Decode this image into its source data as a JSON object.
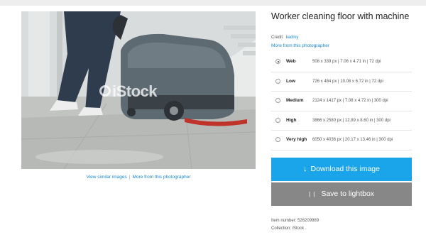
{
  "photo": {
    "title": "Worker cleaning floor with machine",
    "watermark": "iStock",
    "under_links": {
      "similar": "View similar images",
      "separator": "|",
      "more": "More from this photographer"
    }
  },
  "credit": {
    "label": "Credit:",
    "name": "kadmy",
    "more_link": "More from this photographer"
  },
  "sizes": [
    {
      "name": "Web",
      "info": "508 x 339 px | 7.06 x 4.71 in | 72 dpi",
      "selected": true
    },
    {
      "name": "Low",
      "info": "726 x 484 px | 10.08 x 6.72 in | 72 dpi",
      "selected": false
    },
    {
      "name": "Medium",
      "info": "2124 x 1417 px | 7.08 x 4.72 in | 300 dpi",
      "selected": false
    },
    {
      "name": "High",
      "info": "3866 x 2580 px | 12.89 x 8.60 in | 300 dpi",
      "selected": false
    },
    {
      "name": "Very high",
      "info": "6050 x 4036 px | 20.17 x 13.46 in | 300 dpi",
      "selected": false
    }
  ],
  "buttons": {
    "download": {
      "icon": "download-icon",
      "icon_glyph": "↓",
      "label": "Download this image"
    },
    "lightbox": {
      "icon": "lightbox-icon",
      "icon_glyph": "| |",
      "label": "Save to lightbox"
    }
  },
  "meta": {
    "item_number": "Item number:  526209989",
    "collection": "Collection:  iStock"
  },
  "colors": {
    "accent": "#1aa4ea",
    "link": "#1a87d0",
    "secondary_button": "#878787"
  }
}
